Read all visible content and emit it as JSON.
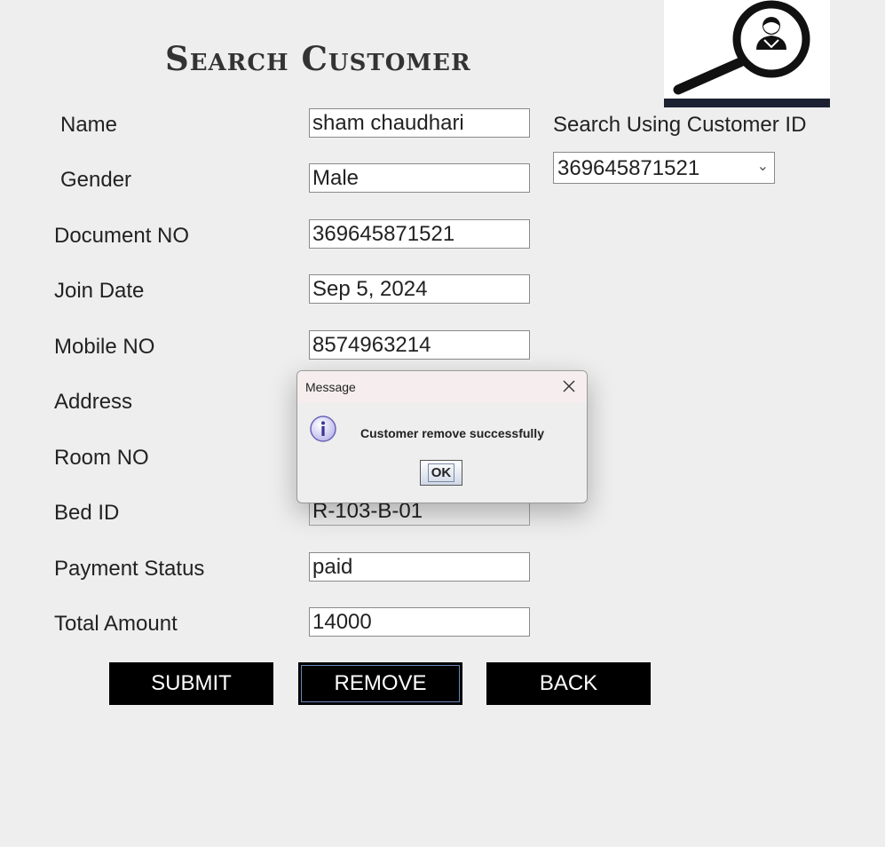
{
  "header": {
    "title": "Search Customer",
    "logo_icon": "customer-search-icon"
  },
  "labels": {
    "name": "Name",
    "gender": "Gender",
    "document_no": "Document NO",
    "join_date": "Join Date",
    "mobile_no": "Mobile NO",
    "address": "Address",
    "room_no": "Room NO",
    "bed_id": "Bed ID",
    "payment_status": "Payment Status",
    "total_amount": "Total Amount",
    "search_by_id": "Search Using Customer ID"
  },
  "fields": {
    "name": "sham chaudhari",
    "gender": "Male",
    "document_no": "369645871521",
    "join_date": "Sep 5, 2024",
    "mobile_no": "8574963214",
    "bed_id": "R-103-B-01",
    "payment_status": "paid",
    "total_amount": "14000"
  },
  "search": {
    "selected_customer_id": "369645871521"
  },
  "buttons": {
    "submit": "SUBMIT",
    "remove": "REMOVE",
    "back": "BACK"
  },
  "dialog": {
    "title": "Message",
    "message": "Customer remove successfully",
    "ok": "OK",
    "icon": "info-icon"
  },
  "colors": {
    "background": "#eeeeee",
    "button_bg": "#000000",
    "button_text": "#ffffff",
    "dialog_header": "#f6eeee"
  }
}
